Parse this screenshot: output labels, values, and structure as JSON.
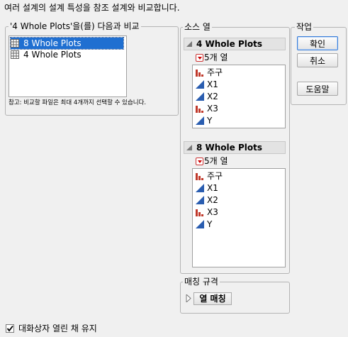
{
  "header": {
    "instruction": "여러 설계의 설계 특성을 참조 설계와 비교합니다."
  },
  "compare_group": {
    "legend": "'4 Whole Plots'을(를) 다음과 비교",
    "items": [
      {
        "label": "8 Whole Plots",
        "selected": true
      },
      {
        "label": "4 Whole Plots",
        "selected": false
      }
    ],
    "note": "참고: 비교할 파일은 최대 4개까지 선택할 수 있습니다."
  },
  "source_group": {
    "legend": "소스 열",
    "panels": [
      {
        "title": "4 Whole Plots",
        "column_count": "5개 열",
        "columns": [
          {
            "label": "주구",
            "icon": "nominal-bar-icon"
          },
          {
            "label": "X1",
            "icon": "continuous-triangle-icon"
          },
          {
            "label": "X2",
            "icon": "continuous-triangle-icon"
          },
          {
            "label": "X3",
            "icon": "nominal-bar-icon"
          },
          {
            "label": "Y",
            "icon": "continuous-triangle-icon"
          }
        ]
      },
      {
        "title": "8 Whole Plots",
        "column_count": "5개 열",
        "columns": [
          {
            "label": "주구",
            "icon": "nominal-bar-icon"
          },
          {
            "label": "X1",
            "icon": "continuous-triangle-icon"
          },
          {
            "label": "X2",
            "icon": "continuous-triangle-icon"
          },
          {
            "label": "X3",
            "icon": "nominal-bar-icon"
          },
          {
            "label": "Y",
            "icon": "continuous-triangle-icon"
          }
        ]
      }
    ]
  },
  "actions_group": {
    "legend": "작업",
    "ok": "확인",
    "cancel": "취소",
    "help": "도움말"
  },
  "matching_group": {
    "legend": "매칭 규격",
    "button": "열 매칭"
  },
  "keep_open": {
    "label": "대화상자 열린 채 유지",
    "checked": true
  },
  "colors": {
    "selection": "#1f6fd1",
    "nominal_icon": "#c0392b",
    "continuous_icon": "#2a5db0"
  }
}
